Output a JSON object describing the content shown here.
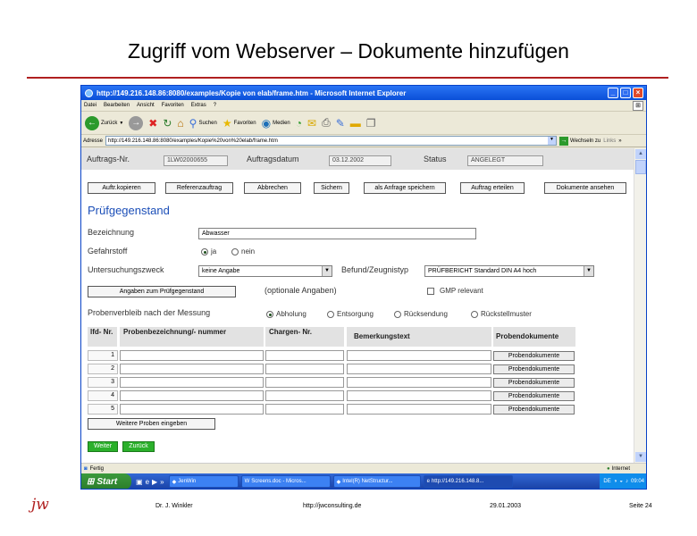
{
  "slide": {
    "title": "Zugriff vom Webserver – Dokumente hinzufügen",
    "footer_author": "Dr. J. Winkler",
    "footer_url": "http://jwconsulting.de",
    "footer_date": "29.01.2003",
    "footer_page": "Seite 24",
    "logo_text": "jw"
  },
  "browser": {
    "window_title": "http://149.216.148.86:8080/examples/Kopie von elab/frame.htm - Microsoft Internet Explorer",
    "menu": [
      "Datei",
      "Bearbeiten",
      "Ansicht",
      "Favoriten",
      "Extras",
      "?"
    ],
    "toolbar": {
      "back": "Zurück",
      "search": "Suchen",
      "favorites": "Favoriten",
      "media": "Medien"
    },
    "address_label": "Adresse",
    "address_value": "http://149.216.148.86:8080/examples/Kopie%20von%20elab/frame.htm",
    "go_label": "Wechseln zu",
    "links_label": "Links",
    "status_text": "Fertig",
    "zone_text": "Internet"
  },
  "form": {
    "order_no_label": "Auftrags-Nr.",
    "order_no_value": "1LW02000655",
    "order_date_label": "Auftragsdatum",
    "order_date_value": "03.12.2002",
    "status_label": "Status",
    "status_value": "ANGELEGT",
    "buttons": {
      "copy": "Auftr.kopieren",
      "reference": "Referenzauftrag",
      "cancel": "Abbrechen",
      "save": "Sichern",
      "save_request": "als Anfrage speichern",
      "create": "Auftrag erteilen",
      "show_docs": "Dokumente ansehen"
    },
    "section_title": "Prüfgegenstand",
    "bezeichnung_label": "Bezeichnung",
    "bezeichnung_value": "Abwasser",
    "gefahrstoff_label": "Gefahrstoff",
    "gefahrstoff_options": [
      "ja",
      "nein"
    ],
    "gefahrstoff_selected": "ja",
    "zweck_label": "Untersuchungszweck",
    "zweck_value": "keine Angabe",
    "befund_label": "Befund/Zeugnistyp",
    "befund_value": "PRÜFBERICHT Standard DIN A4 hoch",
    "angaben_button": "Angaben zum Prüfgegenstand",
    "optional_note": "(optionale Angaben)",
    "gmp_label": "GMP relevant",
    "verbleib_label": "Probenverbleib nach der Messung",
    "verbleib_options": [
      "Abholung",
      "Entsorgung",
      "Rücksendung",
      "Rückstellmuster"
    ],
    "verbleib_selected": "Abholung",
    "table": {
      "col_lfd": "lfd- Nr.",
      "col_name": "Probenbezeichnung/- nummer",
      "col_charge": "Chargen- Nr.",
      "col_remark": "Bemerkungstext",
      "col_docs": "Probendokumente",
      "rows": [
        "1",
        "2",
        "3",
        "4",
        "5"
      ],
      "doc_button": "Probendokumente"
    },
    "more_samples_button": "Weitere Proben eingeben",
    "next_button": "Weiter",
    "back_button": "Zurück"
  },
  "taskbar": {
    "start": "Start",
    "tasks": [
      "JenWin",
      "Screens.doc - Micros...",
      "Intel(R) NetStructur...",
      "http://149.216.148.8..."
    ],
    "tray_lang": "DE",
    "clock": "09:04"
  },
  "colors": {
    "title_rule": "#b02020",
    "section_title": "#1c4fb8",
    "green_button": "#2bb02b",
    "xp_blue": "#0a4fd8"
  }
}
